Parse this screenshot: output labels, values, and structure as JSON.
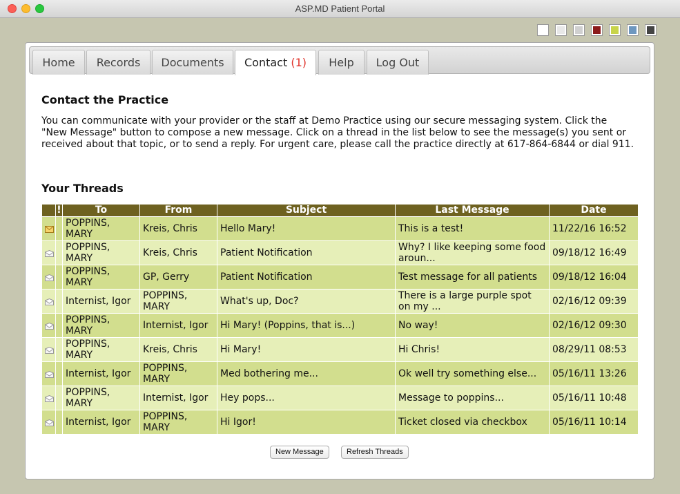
{
  "window": {
    "title": "ASP.MD Patient Portal"
  },
  "theme_swatches": [
    {
      "name": "white",
      "color": "#ffffff"
    },
    {
      "name": "light-gray",
      "color": "#e8e8e8"
    },
    {
      "name": "silver",
      "color": "#d0d0d0"
    },
    {
      "name": "dark-red",
      "color": "#8b1a1a"
    },
    {
      "name": "olive-green",
      "color": "#c8d44a"
    },
    {
      "name": "steel-blue",
      "color": "#6e97bf"
    },
    {
      "name": "charcoal",
      "color": "#444444"
    }
  ],
  "tabs": [
    {
      "id": "home",
      "label": "Home"
    },
    {
      "id": "records",
      "label": "Records"
    },
    {
      "id": "documents",
      "label": "Documents"
    },
    {
      "id": "contact",
      "label": "Contact",
      "badge": "(1)",
      "active": true
    },
    {
      "id": "help",
      "label": "Help"
    },
    {
      "id": "logout",
      "label": "Log Out"
    }
  ],
  "contact": {
    "heading": "Contact the Practice",
    "intro": "You can communicate with your provider or the staff at Demo Practice using our secure messaging system. Click the \"New Message\" button to compose a new message. Click on a thread in the list below to see the message(s) you sent or received about that topic, or to send a reply. For urgent care, please call the practice directly at 617-864-6844 or dial 911."
  },
  "threads": {
    "heading": "Your Threads",
    "columns": {
      "flag": "!",
      "to": "To",
      "from": "From",
      "subject": "Subject",
      "last": "Last Message",
      "date": "Date"
    },
    "rows": [
      {
        "icon": "envelope-unread",
        "to": "POPPINS, MARY",
        "from": "Kreis, Chris",
        "subject": "Hello Mary!",
        "last": "This is a test!",
        "date": "11/22/16 16:52"
      },
      {
        "icon": "envelope-read",
        "to": "POPPINS, MARY",
        "from": "Kreis, Chris",
        "subject": "Patient Notification",
        "last": "Why? I like keeping some food aroun...",
        "date": "09/18/12 16:49"
      },
      {
        "icon": "envelope-read",
        "to": "POPPINS, MARY",
        "from": "GP, Gerry",
        "subject": "Patient Notification",
        "last": "Test message for all patients",
        "date": "09/18/12 16:04"
      },
      {
        "icon": "envelope-read",
        "to": "Internist, Igor",
        "from": "POPPINS, MARY",
        "subject": "What's up, Doc?",
        "last": "There is a large purple spot on my ...",
        "date": "02/16/12 09:39"
      },
      {
        "icon": "envelope-read",
        "to": "POPPINS, MARY",
        "from": "Internist, Igor",
        "subject": "Hi Mary! (Poppins, that is...)",
        "last": "No way!",
        "date": "02/16/12 09:30"
      },
      {
        "icon": "envelope-read",
        "to": "POPPINS, MARY",
        "from": "Kreis, Chris",
        "subject": "Hi Mary!",
        "last": "Hi Chris!",
        "date": "08/29/11 08:53"
      },
      {
        "icon": "envelope-read",
        "to": "Internist, Igor",
        "from": "POPPINS, MARY",
        "subject": "Med bothering me...",
        "last": "Ok well try something else...",
        "date": "05/16/11 13:26"
      },
      {
        "icon": "envelope-read",
        "to": "POPPINS, MARY",
        "from": "Internist, Igor",
        "subject": "Hey pops...",
        "last": "Message to poppins...",
        "date": "05/16/11 10:48"
      },
      {
        "icon": "envelope-read",
        "to": "Internist, Igor",
        "from": "POPPINS, MARY",
        "subject": "Hi Igor!",
        "last": "Ticket closed via checkbox",
        "date": "05/16/11 10:14"
      }
    ]
  },
  "buttons": {
    "new_message": "New Message",
    "refresh": "Refresh Threads"
  }
}
